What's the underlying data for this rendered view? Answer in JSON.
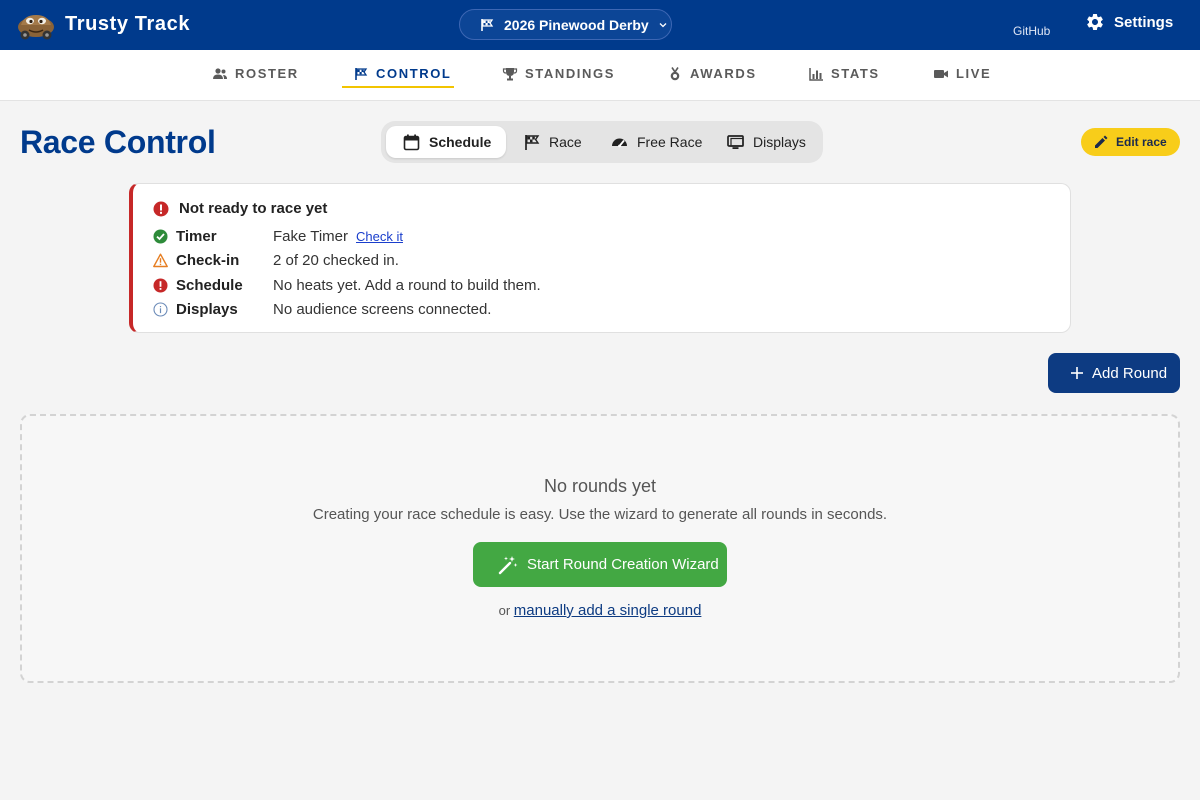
{
  "app": {
    "title": "Trusty Track",
    "race_selector": "2026 Pinewood Derby",
    "github_label": "GitHub",
    "settings_label": "Settings"
  },
  "nav": {
    "items": [
      {
        "label": "ROSTER",
        "icon": "people-icon"
      },
      {
        "label": "CONTROL",
        "icon": "flag-icon",
        "active": true
      },
      {
        "label": "STANDINGS",
        "icon": "trophy-icon"
      },
      {
        "label": "AWARDS",
        "icon": "medal-icon"
      },
      {
        "label": "STATS",
        "icon": "bar-chart-icon"
      },
      {
        "label": "LIVE",
        "icon": "video-camera-icon"
      }
    ]
  },
  "page": {
    "title": "Race Control",
    "edit_label": "Edit race"
  },
  "segments": [
    {
      "label": "Schedule",
      "icon": "calendar-icon",
      "active": true
    },
    {
      "label": "Race",
      "icon": "flag-icon"
    },
    {
      "label": "Free Race",
      "icon": "speedometer-icon"
    },
    {
      "label": "Displays",
      "icon": "monitor-icon"
    }
  ],
  "readiness": {
    "heading": "Not ready to race yet",
    "checks": [
      {
        "name": "Timer",
        "status": "ok",
        "value": "Fake Timer",
        "link": "Check it"
      },
      {
        "name": "Check-in",
        "status": "warning",
        "value": "2 of 20 checked in."
      },
      {
        "name": "Schedule",
        "status": "error",
        "value": "No heats yet. Add a round to build them."
      },
      {
        "name": "Displays",
        "status": "info",
        "value": "No audience screens connected."
      }
    ]
  },
  "actions": {
    "add_round": "Add Round"
  },
  "empty_state": {
    "title": "No rounds yet",
    "subtitle": "Creating your race schedule is easy. Use the wizard to generate all rounds in seconds.",
    "wizard_button": "Start Round Creation Wizard",
    "or_text": "or",
    "manual_link": "manually add a single round"
  },
  "colors": {
    "brand": "#003a8c",
    "accent": "#f8cd1a",
    "success": "#43a843",
    "error": "#c62828",
    "warning": "#e67e22",
    "info": "#6b8bb8"
  }
}
